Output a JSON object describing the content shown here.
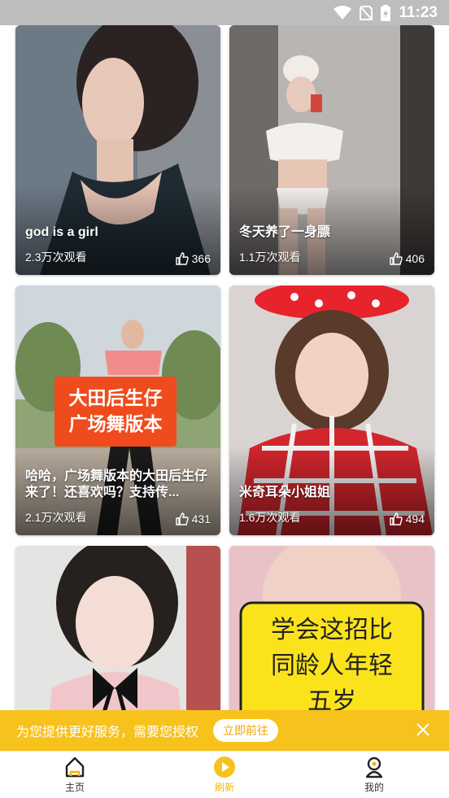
{
  "status_bar": {
    "time": "11:23"
  },
  "cards": [
    {
      "title": "god is a girl",
      "views": "2.3万次观看",
      "likes": "366"
    },
    {
      "title": "冬天养了一身膘",
      "views": "1.1万次观看",
      "likes": "406"
    },
    {
      "title": "哈哈，广场舞版本的大田后生仔来了！还喜欢吗？支持传...",
      "views": "2.1万次观看",
      "likes": "431",
      "overlay_lines": [
        "大田后生仔",
        "广场舞版本"
      ]
    },
    {
      "title": "米奇耳朵小姐姐",
      "views": "1.6万次观看",
      "likes": "494"
    },
    {
      "title": "",
      "views": "",
      "likes": ""
    },
    {
      "title": "",
      "views": "",
      "likes": "",
      "overlay_lines": [
        "学会这招比",
        "同龄人年轻",
        "五岁"
      ]
    }
  ],
  "banner": {
    "message": "为您提供更好服务，需要您授权",
    "action_label": "立即前往"
  },
  "tabs": [
    {
      "label": "主页",
      "icon": "home-icon"
    },
    {
      "label": "刷新",
      "icon": "play-icon",
      "active": true
    },
    {
      "label": "我的",
      "icon": "profile-icon"
    }
  ],
  "colors": {
    "accent": "#f8c21c",
    "active_tab": "#f8b500"
  }
}
